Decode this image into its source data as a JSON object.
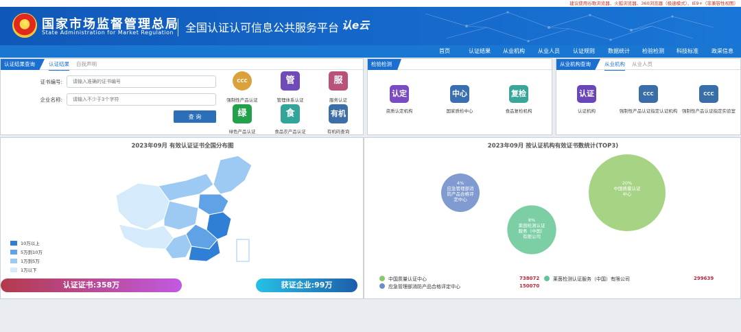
{
  "top_tip": "建议使用谷歌浏览器、火狐浏览器、360浏览器（极速模式）、IE9+（非兼容性视图）",
  "header": {
    "emblem_glyph": "★",
    "org_cn": "国家市场监督管理总局",
    "org_en": "State Administration  for  Market Regulation",
    "platform_title": "全国认证认可信息公共服务平台",
    "logo_mark": "认e云"
  },
  "nav": [
    "首页",
    "认证结果",
    "从业机构",
    "从业人员",
    "认证规则",
    "数据统计",
    "检验检测",
    "科技标准",
    "政采信息"
  ],
  "cert_panel": {
    "tab_active": "认证结果查询",
    "tabs": [
      "认证结果",
      "自我声明"
    ],
    "cert_no_label": "证书编号:",
    "cert_no_placeholder": "请输入准确的证书编号",
    "company_label": "企业名称:",
    "company_placeholder": "请输入不少于3个字符",
    "query_button": "查 询",
    "tiles": [
      {
        "glyph": "CCC",
        "label": "强制性产品认证",
        "color": "#d9a23a"
      },
      {
        "glyph": "管",
        "label": "管理体系认证",
        "color": "#6f4ab8"
      },
      {
        "glyph": "服",
        "label": "服务认证",
        "color": "#b8527a"
      },
      {
        "glyph": "绿",
        "label": "绿色产品认证",
        "color": "#23a04a"
      },
      {
        "glyph": "食",
        "label": "食品农产品认证",
        "color": "#33a49a"
      },
      {
        "glyph": "有机",
        "label": "有机码查询",
        "color": "#3c6ea8"
      }
    ]
  },
  "inspect_panel": {
    "tab_active": "检验检测",
    "tiles": [
      {
        "glyph": "认定",
        "label": "资质认定机构",
        "color": "#7a4cc2"
      },
      {
        "glyph": "中心",
        "label": "国家质检中心",
        "color": "#3a6eb0"
      },
      {
        "glyph": "复检",
        "label": "食品复检机构",
        "color": "#3aa69a"
      }
    ]
  },
  "org_panel": {
    "tab_active": "从业机构查询",
    "tabs": [
      "从业机构",
      "从业人员"
    ],
    "tiles": [
      {
        "glyph": "认证",
        "label": "认证机构",
        "color": "#6a47b8"
      },
      {
        "glyph": "CCC",
        "label": "强制性产品认证指定认证机构",
        "color": "#3a6ea8"
      },
      {
        "glyph": "CCC",
        "label": "强制性产品认证指定实验室",
        "color": "#3a6ea8"
      }
    ]
  },
  "map_panel": {
    "title": "2023年09月  有效认证证书全国分布图",
    "legend": [
      {
        "label": "10万以上",
        "color": "#2f7fd6"
      },
      {
        "label": "5万到10万",
        "color": "#5fa3e6"
      },
      {
        "label": "1万到5万",
        "color": "#9ccaf2"
      },
      {
        "label": "1万以下",
        "color": "#d5ebfb"
      }
    ],
    "cert_stat": "认证证书:358万",
    "company_stat": "获证企业:99万"
  },
  "bubble_panel": {
    "title": "2023年09月   按认证机构有效证书数统计(TOP3)",
    "bubbles": [
      {
        "pct": "4%",
        "name": "应急管理部消防产品合格评定中心",
        "color": "#7f9bd0"
      },
      {
        "pct": "8%",
        "name": "莱茵检测认证服务（中国）有限公司",
        "color": "#7ccfa5"
      },
      {
        "pct": "20%",
        "name": "中国质量认证中心",
        "color": "#a6d484"
      }
    ],
    "legend": [
      {
        "name": "中国质量认证中心",
        "value": "738072",
        "color": "#8cc86a"
      },
      {
        "name": "莱茵检测认证服务（中国）有限公司",
        "value": "299639",
        "color": "#63c39a"
      },
      {
        "name": "应急管理部消防产品合格评定中心",
        "value": "150070",
        "color": "#6f8cc8"
      }
    ]
  },
  "chart_data": {
    "type": "scatter",
    "title": "2023年09月   按认证机构有效证书数统计(TOP3)",
    "series": [
      {
        "name": "中国质量认证中心",
        "values": [
          738072
        ],
        "share": "20%"
      },
      {
        "name": "莱茵检测认证服务（中国）有限公司",
        "values": [
          299639
        ],
        "share": "8%"
      },
      {
        "name": "应急管理部消防产品合格评定中心",
        "values": [
          150070
        ],
        "share": "4%"
      }
    ]
  }
}
